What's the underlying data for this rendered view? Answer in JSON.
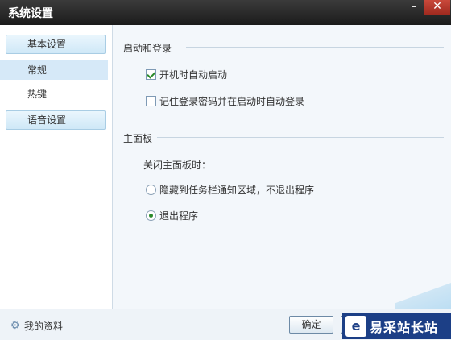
{
  "window": {
    "title": "系统设置",
    "minimize_glyph": "–",
    "close_glyph": "✕"
  },
  "sidebar": {
    "groups": [
      {
        "label": "基本设置"
      },
      {
        "label": "语音设置"
      }
    ],
    "items": [
      {
        "label": "常规",
        "active": true
      },
      {
        "label": "热键",
        "active": false
      }
    ]
  },
  "sections": {
    "startup": {
      "title": "启动和登录",
      "options": [
        {
          "label": "开机时自动启动",
          "checked": true
        },
        {
          "label": "记住登录密码并在启动时自动登录",
          "checked": false
        }
      ]
    },
    "panel": {
      "title": "主面板",
      "subtitle": "关闭主面板时：",
      "options": [
        {
          "label": "隐藏到任务栏通知区域，不退出程序",
          "selected": false
        },
        {
          "label": "退出程序",
          "selected": true
        }
      ]
    }
  },
  "footer": {
    "profile_label": "我的资料",
    "profile_icon": "gear-icon",
    "ok_label": "确定"
  },
  "watermark": {
    "logo_letter": "e",
    "text": "易采站长站"
  }
}
